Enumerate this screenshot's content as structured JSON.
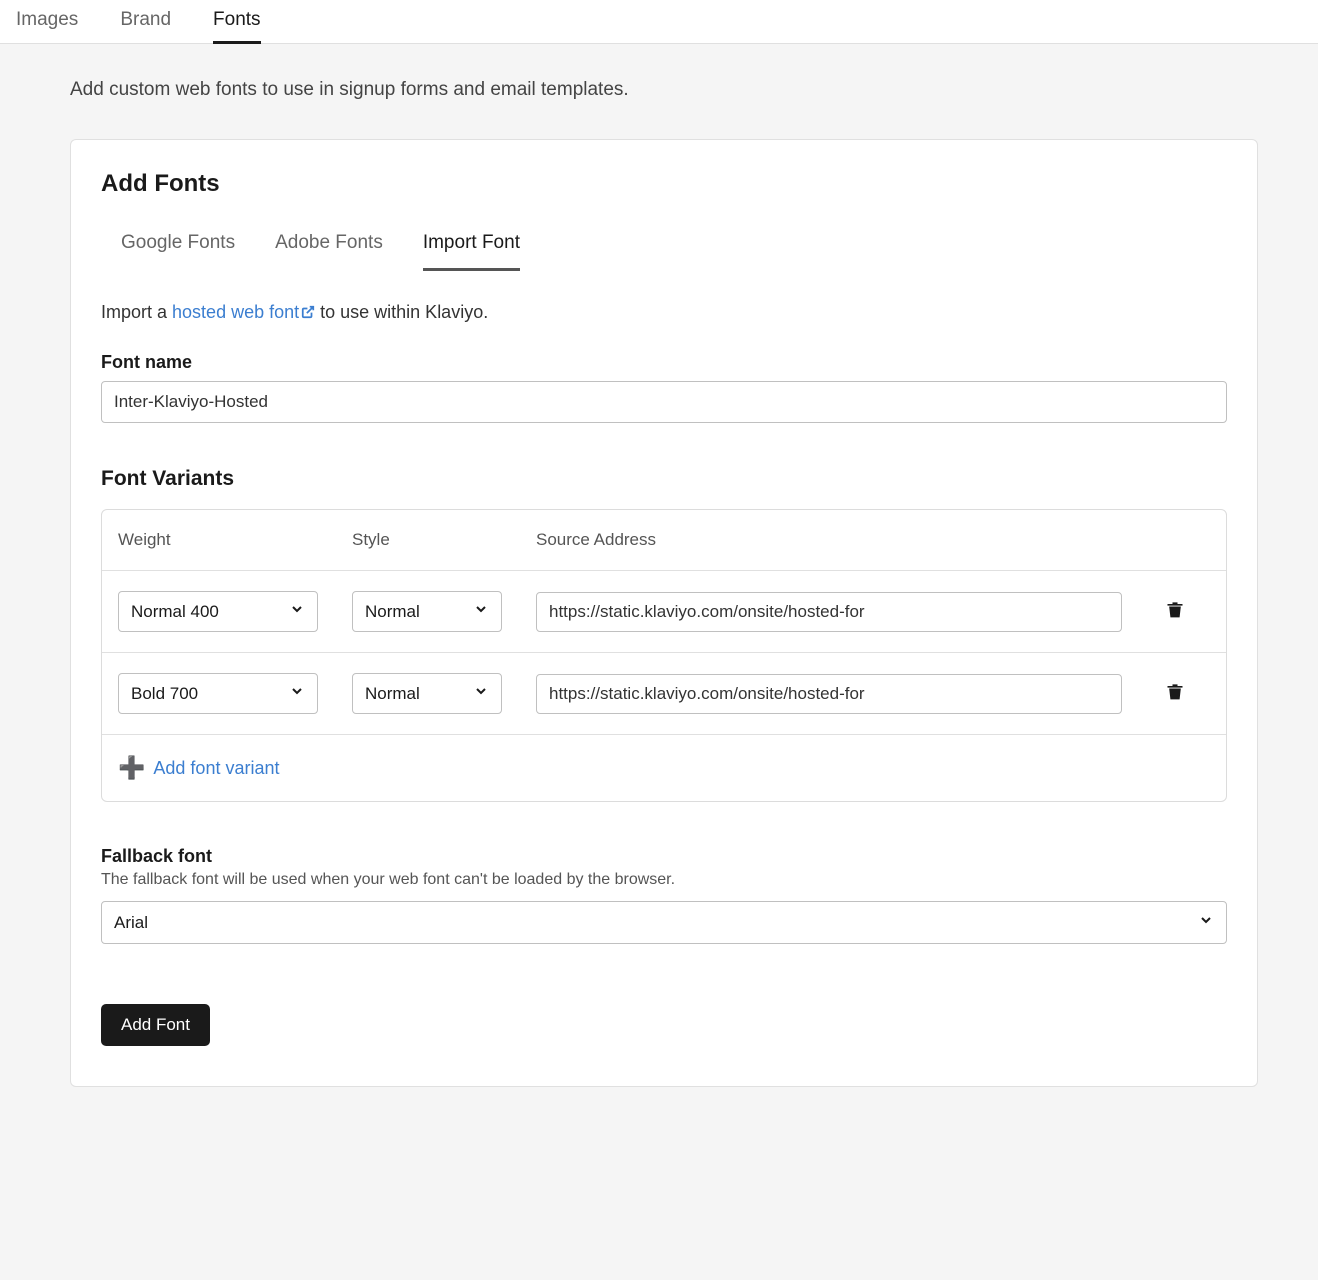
{
  "topTabs": {
    "images": "Images",
    "brand": "Brand",
    "fonts": "Fonts"
  },
  "intro": "Add custom web fonts to use in signup forms and email templates.",
  "card": {
    "title": "Add Fonts",
    "tabs": {
      "google": "Google Fonts",
      "adobe": "Adobe Fonts",
      "import": "Import Font"
    },
    "importDesc": {
      "prefix": "Import a ",
      "link": "hosted web font",
      "suffix": " to use within Klaviyo."
    },
    "fontName": {
      "label": "Font name",
      "value": "Inter-Klaviyo-Hosted"
    },
    "variants": {
      "title": "Font Variants",
      "headers": {
        "weight": "Weight",
        "style": "Style",
        "source": "Source Address"
      },
      "rows": [
        {
          "weight": "Normal 400",
          "style": "Normal",
          "source": "https://static.klaviyo.com/onsite/hosted-for"
        },
        {
          "weight": "Bold 700",
          "style": "Normal",
          "source": "https://static.klaviyo.com/onsite/hosted-for"
        }
      ],
      "addLabel": "Add font variant"
    },
    "fallback": {
      "label": "Fallback font",
      "desc": "The fallback font will be used when your web font can't be loaded by the browser.",
      "value": "Arial"
    },
    "submit": "Add Font"
  }
}
